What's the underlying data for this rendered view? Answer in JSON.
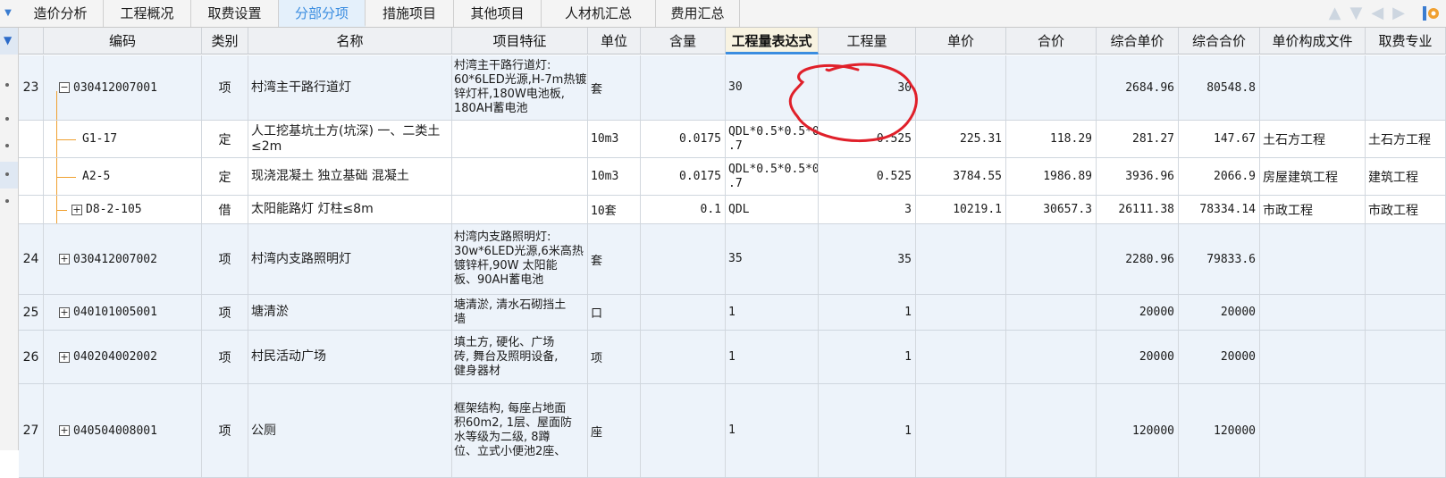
{
  "tabs": [
    {
      "label": "造价分析",
      "active": false
    },
    {
      "label": "工程概况",
      "active": false
    },
    {
      "label": "取费设置",
      "active": false
    },
    {
      "label": "分部分项",
      "active": true
    },
    {
      "label": "措施项目",
      "active": false
    },
    {
      "label": "其他项目",
      "active": false
    },
    {
      "label": "人材机汇总",
      "active": false
    },
    {
      "label": "费用汇总",
      "active": false
    }
  ],
  "toolbar_icons": [
    "arrow-up-icon",
    "arrow-down-icon",
    "arrow-left-icon",
    "arrow-right-icon",
    "settings-corner-icon"
  ],
  "columns": [
    "编码",
    "类别",
    "名称",
    "项目特征",
    "单位",
    "含量",
    "工程量表达式",
    "工程量",
    "单价",
    "合价",
    "综合单价",
    "综合合价",
    "单价构成文件",
    "取费专业"
  ],
  "active_column": "工程量表达式",
  "rows": [
    {
      "num": "23",
      "expander": "−",
      "code": "030412007001",
      "type": "项",
      "name": "村湾主干路行道灯",
      "feature": [
        "村湾主干路行道灯:",
        "60*6LED光源,H-7m热镀",
        "锌灯杆,180W电池板,",
        "180AH蓄电池"
      ],
      "unit": "套",
      "content": "",
      "expr": [
        "30"
      ],
      "qty": "30",
      "price": "",
      "total": "",
      "comp_price": "2684.96",
      "comp_total": "80548.8",
      "file": "",
      "specialty": ""
    },
    {
      "num": "",
      "expander": "",
      "code": "G1-17",
      "type": "定",
      "name": "人工挖基坑土方(坑深) 一、二类土 ≤2m",
      "feature": [],
      "unit": "10m3",
      "content": "0.0175",
      "expr": [
        "QDL*0.5*0.5*0",
        ".7"
      ],
      "qty": "0.525",
      "price": "225.31",
      "total": "118.29",
      "comp_price": "281.27",
      "comp_total": "147.67",
      "file": "土石方工程",
      "specialty": "土石方工程"
    },
    {
      "num": "",
      "expander": "",
      "code": "A2-5",
      "type": "定",
      "name": "现浇混凝土 独立基础 混凝土",
      "feature": [],
      "unit": "10m3",
      "content": "0.0175",
      "expr": [
        "QDL*0.5*0.5*0",
        ".7"
      ],
      "qty": "0.525",
      "price": "3784.55",
      "total": "1986.89",
      "comp_price": "3936.96",
      "comp_total": "2066.9",
      "file": "房屋建筑工程",
      "specialty": "建筑工程"
    },
    {
      "num": "",
      "expander": "+",
      "code": "D8-2-105",
      "type": "借",
      "name": "太阳能路灯 灯柱≤8m",
      "feature": [],
      "unit": "10套",
      "content": "0.1",
      "expr": [
        "QDL"
      ],
      "qty": "3",
      "price": "10219.1",
      "total": "30657.3",
      "comp_price": "26111.38",
      "comp_total": "78334.14",
      "file": "市政工程",
      "specialty": "市政工程"
    },
    {
      "num": "24",
      "expander": "+",
      "code": "030412007002",
      "type": "项",
      "name": "村湾内支路照明灯",
      "feature": [
        "村湾内支路照明灯:",
        "30w*6LED光源,6米高热",
        "镀锌杆,90W 太阳能",
        "板、90AH蓄电池"
      ],
      "unit": "套",
      "content": "",
      "expr": [
        "35"
      ],
      "qty": "35",
      "price": "",
      "total": "",
      "comp_price": "2280.96",
      "comp_total": "79833.6",
      "file": "",
      "specialty": ""
    },
    {
      "num": "25",
      "expander": "+",
      "code": "040101005001",
      "type": "项",
      "name": "塘清淤",
      "feature": [
        "塘清淤, 清水石砌挡土",
        "墙"
      ],
      "unit": "口",
      "content": "",
      "expr": [
        "1"
      ],
      "qty": "1",
      "price": "",
      "total": "",
      "comp_price": "20000",
      "comp_total": "20000",
      "file": "",
      "specialty": ""
    },
    {
      "num": "26",
      "expander": "+",
      "code": "040204002002",
      "type": "项",
      "name": "村民活动广场",
      "feature": [
        "填土方, 硬化、广场",
        "砖, 舞台及照明设备,",
        "健身器材"
      ],
      "unit": "项",
      "content": "",
      "expr": [
        "1"
      ],
      "qty": "1",
      "price": "",
      "total": "",
      "comp_price": "20000",
      "comp_total": "20000",
      "file": "",
      "specialty": ""
    },
    {
      "num": "27",
      "expander": "+",
      "code": "040504008001",
      "type": "项",
      "name": "公厕",
      "feature": [
        "框架结构, 每座占地面",
        "积60m2, 1层、屋面防",
        "水等级为二级, 8蹲",
        "位、立式小便池2座、"
      ],
      "unit": "座",
      "content": "",
      "expr": [
        "1"
      ],
      "qty": "1",
      "price": "",
      "total": "",
      "comp_price": "120000",
      "comp_total": "120000",
      "file": "",
      "specialty": ""
    }
  ],
  "annotation": {
    "kind": "hand-drawn circle",
    "color": "#e0202a"
  }
}
